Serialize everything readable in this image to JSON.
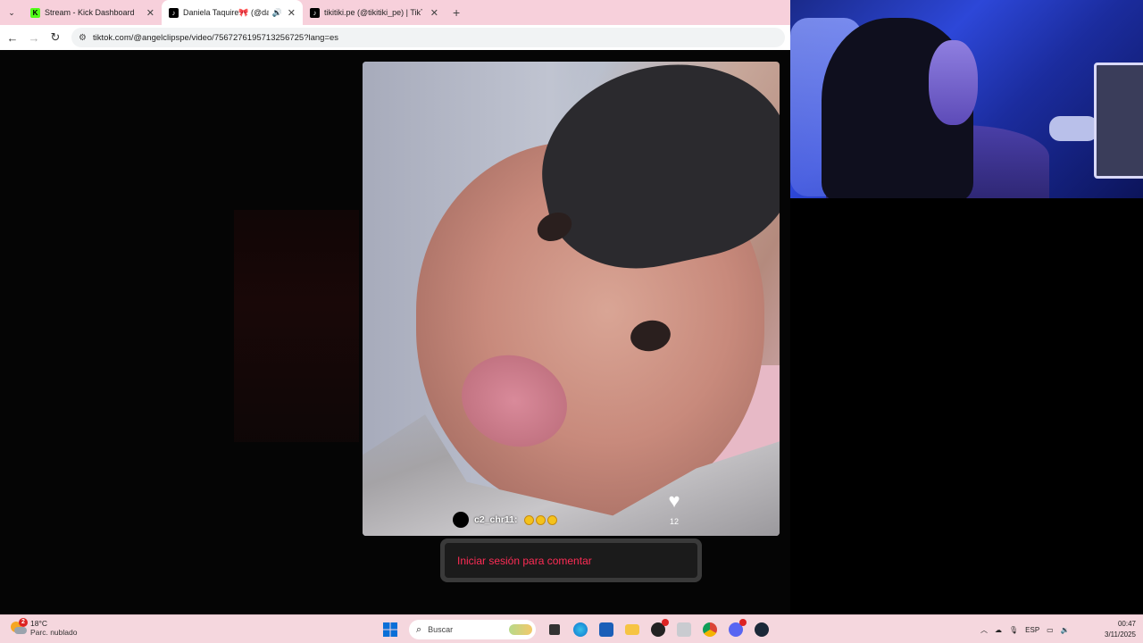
{
  "browser": {
    "tabs": [
      {
        "title": "Stream - Kick Dashboard",
        "icon": "kick-icon",
        "icon_color": "#53fc18"
      },
      {
        "title": "Daniela Taquire🎀 (@danie",
        "icon": "tiktok-icon",
        "icon_color": "#000000",
        "active": true,
        "audio": true
      },
      {
        "title": "tikitiki.pe (@tikitiki_pe) | TikTok",
        "icon": "tiktok-icon",
        "icon_color": "#000000"
      }
    ],
    "new_tab": "+",
    "url": "tiktok.com/@angelclipspe/video/7567276195713256725?lang=es"
  },
  "video": {
    "comment": {
      "user": "c2_chr11:",
      "emojis": [
        "rofl-emoji",
        "rofl-emoji",
        "rofl-emoji"
      ]
    },
    "likes": "12"
  },
  "login_button": "Iniciar sesión para comentar",
  "taskbar": {
    "weather_temp": "18°C",
    "weather_desc": "Parc. nublado",
    "weather_badge": "2",
    "search_placeholder": "Buscar",
    "language": "ESP",
    "time": "00:47",
    "date": "3/11/2025"
  },
  "colors": {
    "tab_strip": "#f7d0db",
    "tiktok_red": "#fe2c55",
    "taskbar": "#f5d7de"
  }
}
